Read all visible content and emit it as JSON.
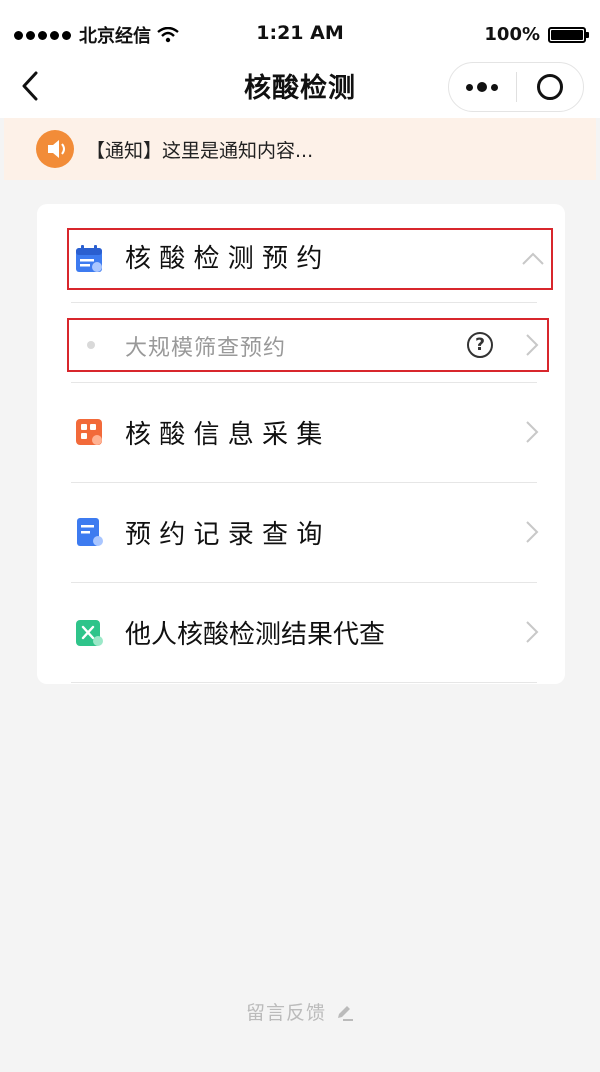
{
  "status_bar": {
    "carrier": "北京经信",
    "time": "1:21 AM",
    "battery": "100%"
  },
  "nav": {
    "title": "核酸检测"
  },
  "notice": {
    "text": "【通知】这里是通知内容..."
  },
  "menu": {
    "appointment": {
      "label": "核 酸 检 测 预 约",
      "icon": "calendar-icon"
    },
    "sub_appointment": {
      "label": "大规模筛查预约",
      "help": "?"
    },
    "info_collection": {
      "label": "核 酸 信 息 采 集",
      "icon": "grid-form-icon"
    },
    "records": {
      "label": "预 约 记 录 查 询",
      "icon": "document-search-icon"
    },
    "proxy_query": {
      "label": "他人核酸检测结果代查",
      "icon": "virus-check-icon"
    }
  },
  "footer": {
    "feedback": "留言反馈"
  },
  "colors": {
    "accent_red": "#d8262c",
    "notice_bg": "#fdf1e8",
    "notice_icon": "#f28c38",
    "icon_blue": "#3d7bf0",
    "icon_orange": "#f26a3a",
    "icon_green": "#2fc48a"
  }
}
